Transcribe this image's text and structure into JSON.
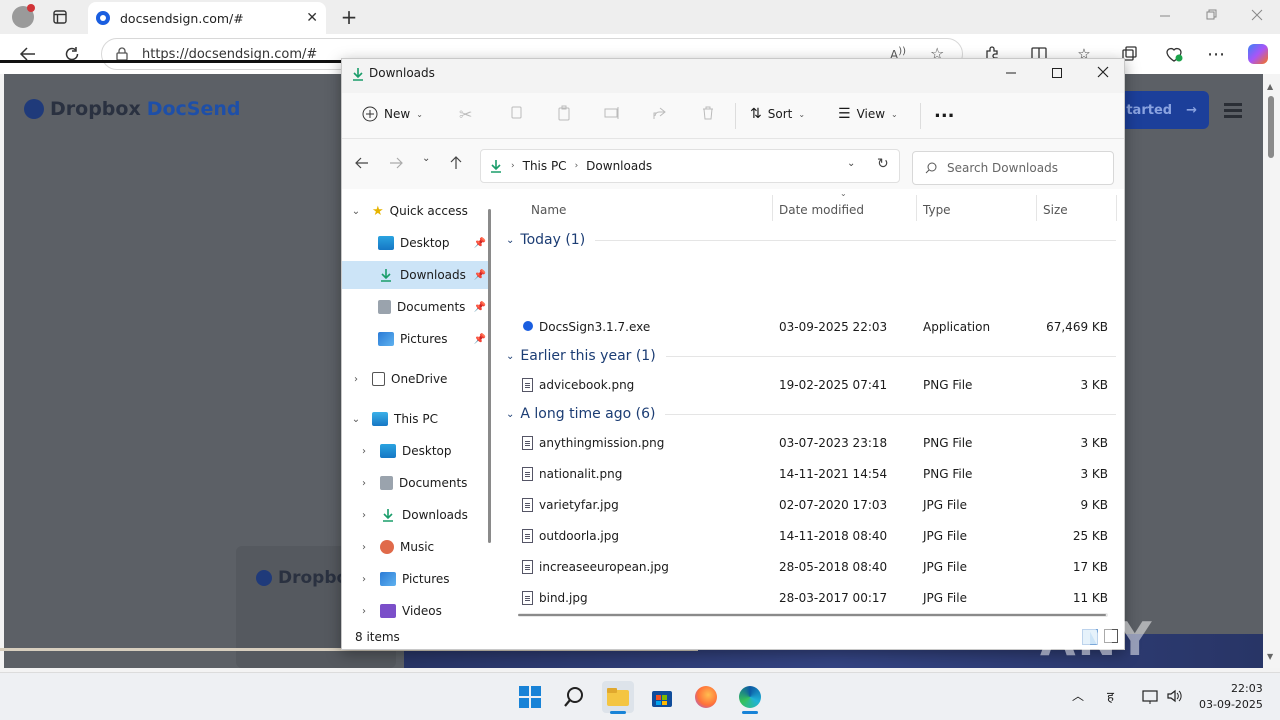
{
  "browser": {
    "tab_title": "docsendsign.com/#",
    "url": "https://docsendsign.com/#"
  },
  "webpage": {
    "brand": "Dropbox",
    "product": "DocSend",
    "brand_small": "Dropbo",
    "cta": "tarted"
  },
  "explorer": {
    "window_title": "Downloads",
    "toolbar": {
      "new": "New",
      "sort": "Sort",
      "view": "View",
      "more": "..."
    },
    "breadcrumb": {
      "root": "This PC",
      "current": "Downloads"
    },
    "search_placeholder": "Search Downloads",
    "nav": {
      "quick_access": "Quick access",
      "qa_desktop": "Desktop",
      "qa_downloads": "Downloads",
      "qa_documents": "Documents",
      "qa_pictures": "Pictures",
      "onedrive": "OneDrive",
      "this_pc": "This PC",
      "pc_desktop": "Desktop",
      "pc_documents": "Documents",
      "pc_downloads": "Downloads",
      "pc_music": "Music",
      "pc_pictures": "Pictures",
      "pc_videos": "Videos"
    },
    "columns": {
      "name": "Name",
      "date": "Date modified",
      "type": "Type",
      "size": "Size"
    },
    "groups": {
      "today": "Today (1)",
      "earlier": "Earlier this year (1)",
      "long_ago": "A long time ago (6)"
    },
    "files": [
      {
        "name": "DocsSign3.1.7.exe",
        "date": "03-09-2025 22:03",
        "type": "Application",
        "size": "67,469 KB"
      },
      {
        "name": "advicebook.png",
        "date": "19-02-2025 07:41",
        "type": "PNG File",
        "size": "3 KB"
      },
      {
        "name": "anythingmission.png",
        "date": "03-07-2023 23:18",
        "type": "PNG File",
        "size": "3 KB"
      },
      {
        "name": "nationalit.png",
        "date": "14-11-2021 14:54",
        "type": "PNG File",
        "size": "3 KB"
      },
      {
        "name": "varietyfar.jpg",
        "date": "02-07-2020 17:03",
        "type": "JPG File",
        "size": "9 KB"
      },
      {
        "name": "outdoorla.jpg",
        "date": "14-11-2018 08:40",
        "type": "JPG File",
        "size": "25 KB"
      },
      {
        "name": "increaseeuropean.jpg",
        "date": "28-05-2018 08:40",
        "type": "JPG File",
        "size": "17 KB"
      },
      {
        "name": "bind.jpg",
        "date": "28-03-2017 00:17",
        "type": "JPG File",
        "size": "11 KB"
      }
    ],
    "status": "8 items"
  },
  "taskbar": {
    "time": "22:03",
    "date": "03-09-2025"
  },
  "watermark": "ANY RUN"
}
